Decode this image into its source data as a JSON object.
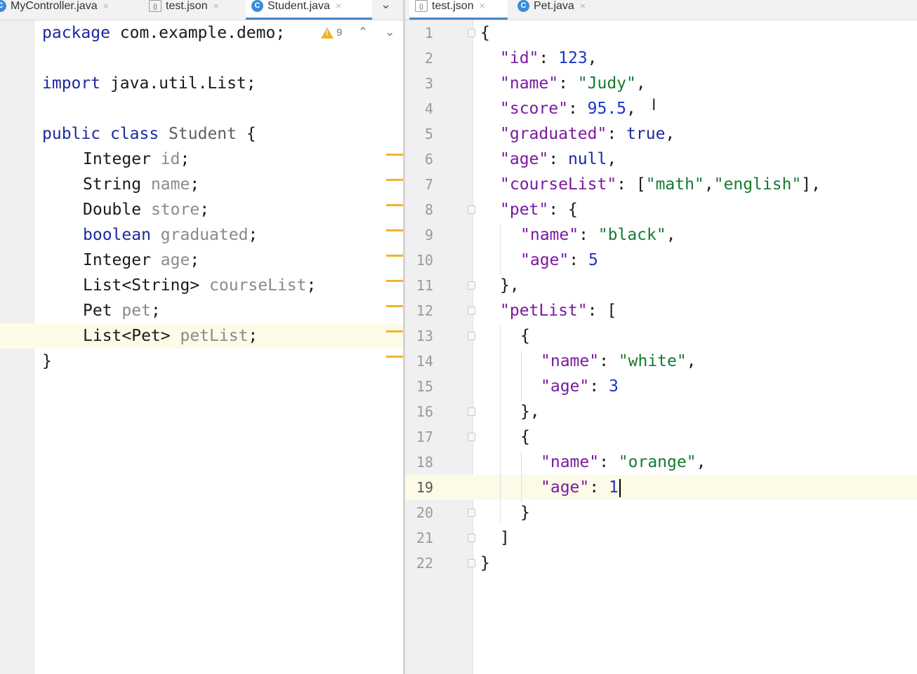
{
  "left_tabs": [
    {
      "label": "MyController.java",
      "icon": "class-icon"
    },
    {
      "label": "test.json",
      "icon": "json-file-icon"
    },
    {
      "label": "Student.java",
      "icon": "class-icon",
      "active": true
    }
  ],
  "right_tabs": [
    {
      "label": "test.json",
      "icon": "json-file-icon",
      "active": true
    },
    {
      "label": "Pet.java",
      "icon": "class-icon"
    }
  ],
  "class_icon_letter": "C",
  "json_icon_glyph": "{}",
  "close_glyph": "×",
  "inspection": {
    "warning_count": "9"
  },
  "colors": {
    "accent": "#4a86c8",
    "warning": "#f0b429",
    "keyword": "#1b2aa0",
    "string": "#167a2f",
    "number": "#1b36c8",
    "current_line": "#fdfbe8"
  },
  "left_editor": {
    "lines": {
      "l1": {
        "kw": "package",
        "rest": " com.example.demo;"
      },
      "l3": {
        "kw": "import",
        "rest": " java.util.List;"
      },
      "l5": {
        "kw1": "public",
        "kw2": "class",
        "name": "Student",
        "rest": " {"
      },
      "l6": {
        "type": "Integer",
        "field": "id",
        "end": ";"
      },
      "l7": {
        "type": "String",
        "field": "name",
        "end": ";"
      },
      "l8": {
        "type": "Double",
        "field": "store",
        "end": ";"
      },
      "l9": {
        "type": "boolean",
        "field": "graduated",
        "end": ";"
      },
      "l10": {
        "type": "Integer",
        "field": "age",
        "end": ";"
      },
      "l11": {
        "type": "List<String>",
        "field": "courseList",
        "end": ";"
      },
      "l12": {
        "type": "Pet",
        "field": "pet",
        "end": ";"
      },
      "l13": {
        "type": "List<Pet>",
        "field": "petList",
        "end": ";"
      },
      "l14": {
        "text": "}"
      }
    }
  },
  "right_editor": {
    "line_numbers": [
      "1",
      "2",
      "3",
      "4",
      "5",
      "6",
      "7",
      "8",
      "9",
      "10",
      "11",
      "12",
      "13",
      "14",
      "15",
      "16",
      "17",
      "18",
      "19",
      "20",
      "21",
      "22"
    ],
    "current_line": "19",
    "lines": {
      "r1": "{",
      "r2": {
        "key": "\"id\"",
        "sep": ": ",
        "val": "123",
        "end": ","
      },
      "r3": {
        "key": "\"name\"",
        "sep": ": ",
        "val": "\"Judy\"",
        "end": ","
      },
      "r4": {
        "key": "\"score\"",
        "sep": ": ",
        "val": "95.5",
        "end": ","
      },
      "r5": {
        "key": "\"graduated\"",
        "sep": ": ",
        "val": "true",
        "end": ","
      },
      "r6": {
        "key": "\"age\"",
        "sep": ": ",
        "val": "null",
        "end": ","
      },
      "r7": {
        "key": "\"courseList\"",
        "sep": ": [",
        "v1": "\"math\"",
        "comma": ",",
        "v2": "\"english\"",
        "end": "],"
      },
      "r8": {
        "key": "\"pet\"",
        "end": ": {"
      },
      "r9": {
        "key": "\"name\"",
        "sep": ": ",
        "val": "\"black\"",
        "end": ","
      },
      "r10": {
        "key": "\"age\"",
        "sep": ": ",
        "val": "5"
      },
      "r11": "},",
      "r12": {
        "key": "\"petList\"",
        "end": ": ["
      },
      "r13": "{",
      "r14": {
        "key": "\"name\"",
        "sep": ": ",
        "val": "\"white\"",
        "end": ","
      },
      "r15": {
        "key": "\"age\"",
        "sep": ": ",
        "val": "3"
      },
      "r16": "},",
      "r17": "{",
      "r18": {
        "key": "\"name\"",
        "sep": ": ",
        "val": "\"orange\"",
        "end": ","
      },
      "r19": {
        "key": "\"age\"",
        "sep": ": ",
        "val": "1"
      },
      "r20": "}",
      "r21": "]",
      "r22": "}"
    }
  }
}
